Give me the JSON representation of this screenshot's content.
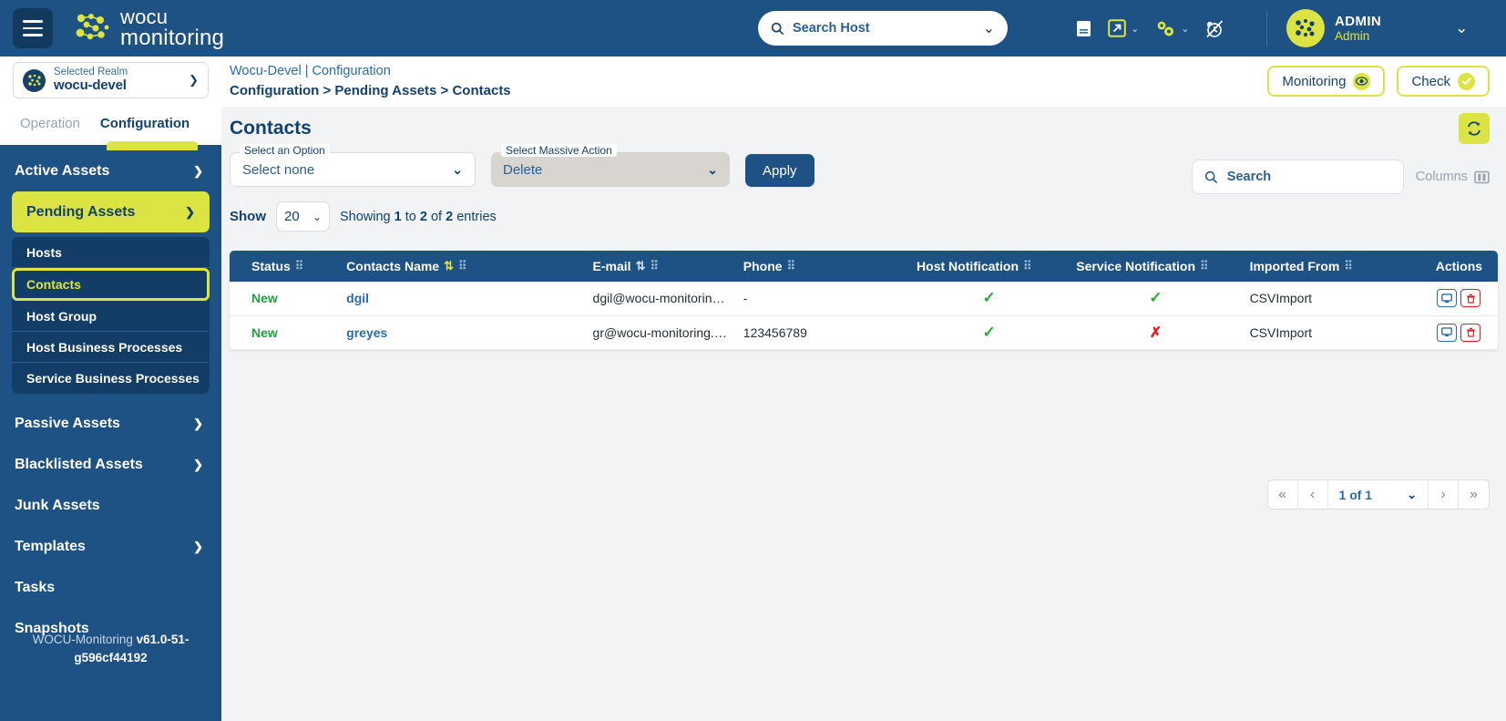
{
  "header": {
    "brand_line1": "wocu",
    "brand_line2": "monitoring",
    "host_search_placeholder": "Search Host",
    "icons": [
      "document-icon",
      "external-link-icon",
      "gears-icon",
      "clock-disabled-icon"
    ],
    "user": {
      "name": "ADMIN",
      "role": "Admin"
    },
    "colors": {
      "navy": "#1e5184",
      "lime": "#dbe442",
      "dark_navy": "#133a5e"
    }
  },
  "realm": {
    "label": "Selected Realm",
    "value": "wocu-devel"
  },
  "tabs": [
    {
      "label": "Operation",
      "active": false
    },
    {
      "label": "Configuration",
      "active": true
    }
  ],
  "sidebar": {
    "groups": [
      {
        "label": "Active Assets",
        "expanded": false,
        "highlighted": false
      },
      {
        "label": "Pending Assets",
        "expanded": true,
        "highlighted": true
      }
    ],
    "subitems": [
      {
        "label": "Hosts",
        "selected": false
      },
      {
        "label": "Contacts",
        "selected": true
      },
      {
        "label": "Host Group",
        "selected": false
      },
      {
        "label": "Host Business Processes",
        "selected": false
      },
      {
        "label": "Service Business Processes",
        "selected": false
      }
    ],
    "groups2": [
      {
        "label": "Passive Assets",
        "expanded": false
      },
      {
        "label": "Blacklisted Assets",
        "expanded": false
      }
    ],
    "simple1": "Junk Assets",
    "groups3": [
      {
        "label": "Templates",
        "expanded": false
      }
    ],
    "simple2": "Tasks",
    "simple3": "Snapshots",
    "version_prefix": "WOCU-Monitoring ",
    "version_value": "v61.0-51-g596cf44192"
  },
  "breadcrumb": {
    "line1": "Wocu-Devel | Configuration",
    "line2": "Configuration > Pending Assets > Contacts"
  },
  "top_buttons": [
    {
      "label": "Monitoring",
      "icon": "eye-icon"
    },
    {
      "label": "Check",
      "icon": "check-circle-icon"
    }
  ],
  "page": {
    "title": "Contacts",
    "refresh_icon": "refresh-icon"
  },
  "filters": {
    "option": {
      "label": "Select an Option",
      "value": "Select none"
    },
    "massive": {
      "label": "Select Massive Action",
      "value": "Delete"
    },
    "apply_label": "Apply"
  },
  "search": {
    "placeholder": "Search",
    "icon": "search-icon"
  },
  "columns_button": {
    "label": "Columns",
    "icon": "columns-icon"
  },
  "show": {
    "label": "Show",
    "value": "20",
    "info_prefix": "Showing ",
    "info_from": "1",
    "info_mid": " to ",
    "info_to": "2",
    "info_mid2": " of ",
    "info_total": "2",
    "info_suffix": " entries"
  },
  "table": {
    "columns": [
      {
        "label": "Status",
        "sortable": false,
        "grip": true
      },
      {
        "label": "Contacts Name",
        "sortable": true,
        "sort_active": true,
        "grip": true
      },
      {
        "label": "E-mail",
        "sortable": true,
        "sort_active": false,
        "grip": true
      },
      {
        "label": "Phone",
        "sortable": false,
        "grip": true
      },
      {
        "label": "Host Notification",
        "sortable": false,
        "grip": true
      },
      {
        "label": "Service Notification",
        "sortable": false,
        "grip": true
      },
      {
        "label": "Imported From",
        "sortable": false,
        "grip": true
      },
      {
        "label": "Actions",
        "sortable": false,
        "grip": false
      }
    ],
    "rows": [
      {
        "status": "New",
        "name": "dgil",
        "email": "dgil@wocu-monitoring.c…",
        "phone": "-",
        "host_notification": "✓",
        "service_notification": "✓",
        "imported_from": "CSVImport",
        "actions": [
          "monitor-icon",
          "trash-icon"
        ]
      },
      {
        "status": "New",
        "name": "greyes",
        "email": "gr@wocu-monitoring.com",
        "phone": "123456789",
        "host_notification": "✓",
        "service_notification": "✗",
        "imported_from": "CSVImport",
        "actions": [
          "monitor-icon",
          "trash-icon"
        ]
      }
    ]
  },
  "pagination": {
    "first": "«",
    "prev": "‹",
    "page_text": "1 of 1",
    "next": "›",
    "last": "»"
  }
}
